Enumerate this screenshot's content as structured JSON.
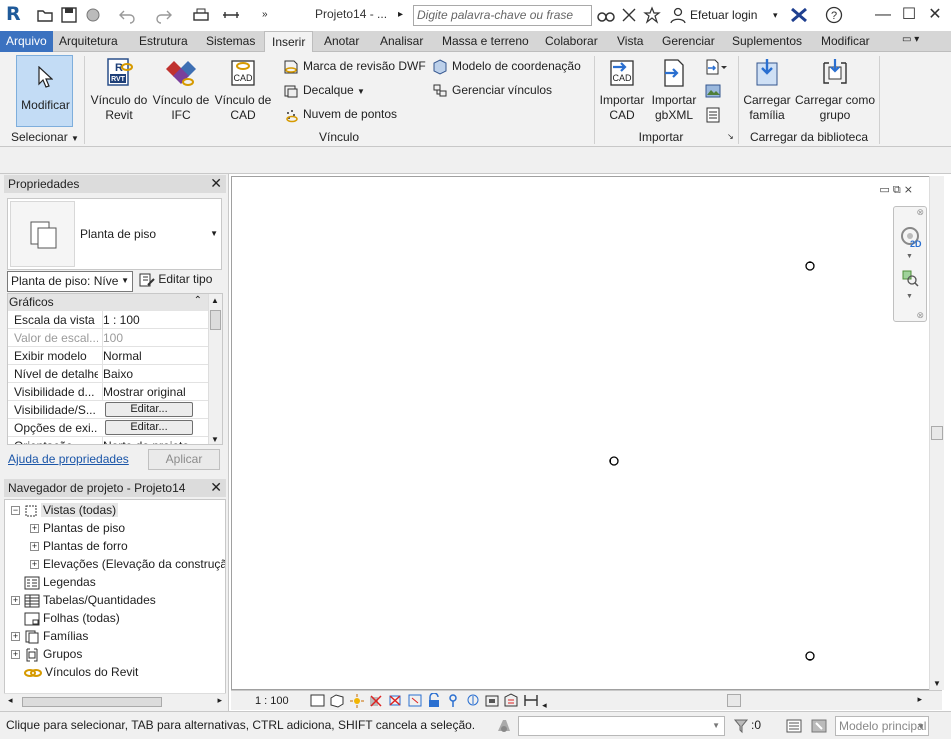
{
  "titlebar": {
    "app_letter": "R",
    "title": "Projeto14 - ...",
    "search_placeholder": "Digite palavra-chave ou frase",
    "login": "Efetuar login"
  },
  "tabs": [
    {
      "label": "Arquivo"
    },
    {
      "label": "Arquitetura"
    },
    {
      "label": "Estrutura"
    },
    {
      "label": "Sistemas"
    },
    {
      "label": "Inserir"
    },
    {
      "label": "Anotar"
    },
    {
      "label": "Analisar"
    },
    {
      "label": "Massa e terreno"
    },
    {
      "label": "Colaborar"
    },
    {
      "label": "Vista"
    },
    {
      "label": "Gerenciar"
    },
    {
      "label": "Suplementos"
    },
    {
      "label": "Modificar"
    }
  ],
  "ribbon": {
    "select": {
      "button": "Modificar",
      "panel": "Selecionar"
    },
    "link": {
      "panel": "Vínculo",
      "revit": [
        "Vínculo do",
        "Revit"
      ],
      "ifc": [
        "Vínculo de",
        "IFC"
      ],
      "cad": [
        "Vínculo de",
        "CAD"
      ],
      "dwf": "Marca de revisão  DWF",
      "decal": "Decalque",
      "pointcloud": "Nuvem  de pontos",
      "coordination": "Modelo de  coordenação",
      "manage": "Gerenciar  vínculos"
    },
    "import": {
      "panel": "Importar",
      "cad": [
        "Importar",
        "CAD"
      ],
      "gbxml": [
        "Importar",
        "gbXML"
      ]
    },
    "library": {
      "panel": "Carregar da biblioteca",
      "family": [
        "Carregar",
        "família"
      ],
      "group": [
        "Carregar como",
        "grupo"
      ]
    }
  },
  "properties": {
    "title": "Propriedades",
    "type_name": "Planta de piso",
    "selector": "Planta de piso: Níve",
    "edit_type": "Editar tipo",
    "category": "Gráficos",
    "rows": [
      {
        "key": "Escala da vista",
        "value": "1 : 100",
        "dim": false
      },
      {
        "key": "Valor de escal...",
        "value": "100",
        "dim": true
      },
      {
        "key": "Exibir modelo",
        "value": "Normal",
        "dim": false
      },
      {
        "key": "Nível de detalhe",
        "value": "Baixo",
        "dim": false
      },
      {
        "key": "Visibilidade d...",
        "value": "Mostrar original",
        "dim": false
      },
      {
        "key": "Visibilidade/S...",
        "button": "Editar...",
        "dim": false
      },
      {
        "key": "Opções de exi...",
        "button": "Editar...",
        "dim": false
      },
      {
        "key": "Orientação",
        "value": "Norte do projeto",
        "dim": false
      }
    ],
    "help": "Ajuda de propriedades",
    "apply": "Aplicar"
  },
  "browser": {
    "title": "Navegador de projeto - Projeto14",
    "items": [
      {
        "label": "Vistas (todas)",
        "level": 0,
        "expander": "−"
      },
      {
        "label": "Plantas de piso",
        "level": 1,
        "expander": "+"
      },
      {
        "label": "Plantas de forro",
        "level": 1,
        "expander": "+"
      },
      {
        "label": "Elevações (Elevação da construção)",
        "level": 1,
        "expander": "+"
      },
      {
        "label": "Legendas",
        "level": 0,
        "expander": ""
      },
      {
        "label": "Tabelas/Quantidades",
        "level": 0,
        "expander": "+"
      },
      {
        "label": "Folhas (todas)",
        "level": 0,
        "expander": ""
      },
      {
        "label": "Famílias",
        "level": 0,
        "expander": "+"
      },
      {
        "label": "Grupos",
        "level": 0,
        "expander": "+"
      },
      {
        "label": "Vínculos do Revit",
        "level": 0,
        "expander": ""
      }
    ]
  },
  "viewcontrol": {
    "scale": "1 : 100"
  },
  "navbar": {
    "label_2d": "2D"
  },
  "status": {
    "message": "Clique para selecionar, TAB para alternativas, CTRL adiciona, SHIFT cancela a seleção.",
    "count": ":0",
    "model": "Modelo principal"
  },
  "colors": {
    "accent": "#3b72c0",
    "selected_btn": "#c3dcf5",
    "link": "#1a55a8"
  }
}
